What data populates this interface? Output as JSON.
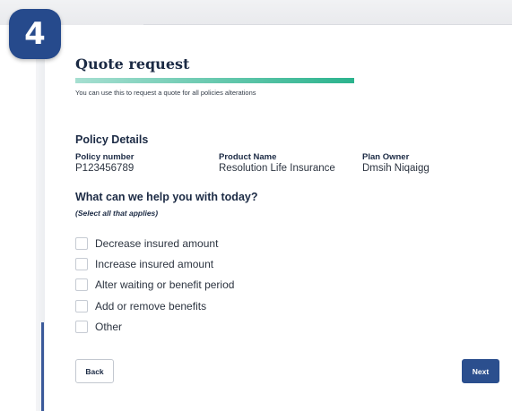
{
  "step": {
    "number": "4"
  },
  "page": {
    "title": "Quote request",
    "subtitle": "You can use this to request a quote for all policies alterations",
    "progress": 1.0
  },
  "policy": {
    "section_title": "Policy Details",
    "fields": [
      {
        "label": "Policy number",
        "value": "P123456789"
      },
      {
        "label": "Product Name",
        "value": "Resolution Life Insurance"
      },
      {
        "label": "Plan Owner",
        "value": "Dmsih Niqaigg"
      }
    ]
  },
  "help": {
    "question": "What can we help you with today?",
    "hint": "(Select all that applies)",
    "options": [
      {
        "label": "Decrease insured amount",
        "checked": false
      },
      {
        "label": "Increase insured amount",
        "checked": false
      },
      {
        "label": "Alter waiting or benefit period",
        "checked": false
      },
      {
        "label": "Add or remove benefits",
        "checked": false
      },
      {
        "label": "Other",
        "checked": false
      }
    ]
  },
  "buttons": {
    "back": "Back",
    "next": "Next"
  },
  "colors": {
    "badge": "#264a8c",
    "primary_button": "#2b4f8e",
    "progress_start": "#a6dfd1",
    "progress_end": "#2bb38d"
  }
}
